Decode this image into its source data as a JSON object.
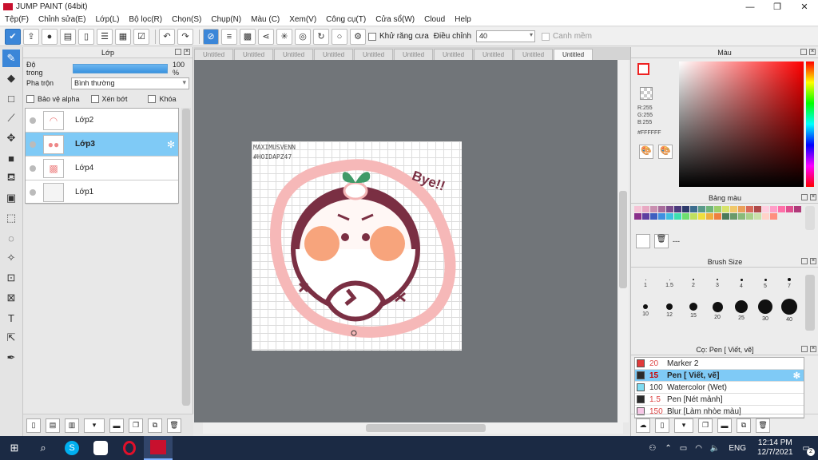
{
  "app": {
    "title": "JUMP PAINT (64bit)",
    "min": "—",
    "max": "❐",
    "close": "✕"
  },
  "menu": [
    "Tệp(F)",
    "Chỉnh sửa(E)",
    "Lớp(L)",
    "Bộ lọc(R)",
    "Chọn(S)",
    "Chụp(N)",
    "Màu (C)",
    "Xem(V)",
    "Công cụ(T)",
    "Cửa sổ(W)",
    "Cloud",
    "Help"
  ],
  "toolbar": {
    "antialias": "Khử răng cưa",
    "adjust_label": "Điều chỉnh",
    "adjust_value": "40",
    "snap": "Canh mềm"
  },
  "layer_panel": {
    "title": "Lớp",
    "opacity_label": "Độ trong",
    "opacity_value": "100 %",
    "opacity": 1.0,
    "blend_label": "Pha trộn",
    "blend_value": "Bình thường",
    "protect_alpha": "Bảo vệ alpha",
    "clip": "Xén bớt",
    "lock": "Khóa",
    "layers": [
      {
        "name": "Lớp2"
      },
      {
        "name": "Lớp3"
      },
      {
        "name": "Lớp4"
      },
      {
        "name": "Lớp1"
      }
    ]
  },
  "tabs": [
    "Untitled",
    "Untitled",
    "Untitled",
    "Untitled",
    "Untitled",
    "Untitled",
    "Untitled",
    "Untitled",
    "Untitled",
    "Untitled"
  ],
  "canvas": {
    "watermark1": "MAXIMUSVENN",
    "watermark2": "#HOIDAPZ47",
    "bye_text": "Bye!!"
  },
  "color_panel": {
    "title": "Màu",
    "r": "R:255",
    "g": "G:255",
    "b": "B:255",
    "hex": "#FFFFFF"
  },
  "palette_panel": {
    "title": "Bảng màu",
    "more": "---"
  },
  "brush_size_panel": {
    "title": "Brush Size",
    "sizes": [
      "1",
      "1.5",
      "2",
      "3",
      "4",
      "5",
      "7",
      "10",
      "12",
      "15",
      "20",
      "25",
      "30",
      "40"
    ]
  },
  "brush_panel": {
    "title": "Cọ: Pen [ Viết, vẽ]",
    "items": [
      {
        "size": "20",
        "name": "Marker 2",
        "color": "#e23a3a"
      },
      {
        "size": "15",
        "name": "Pen [ Viết, vẽ]",
        "color": "#2a2a2a"
      },
      {
        "size": "100",
        "name": "Watercolor (Wet)",
        "color": "#7fdcf2"
      },
      {
        "size": "1.5",
        "name": "Pen [Nét mảnh]",
        "color": "#2a2a2a"
      },
      {
        "size": "150",
        "name": "Blur [Làm nhòe màu]",
        "color": "#f7c6e6"
      }
    ]
  },
  "taskbar": {
    "lang": "ENG",
    "time": "12:14 PM",
    "date": "12/7/2021",
    "notif": "2"
  }
}
